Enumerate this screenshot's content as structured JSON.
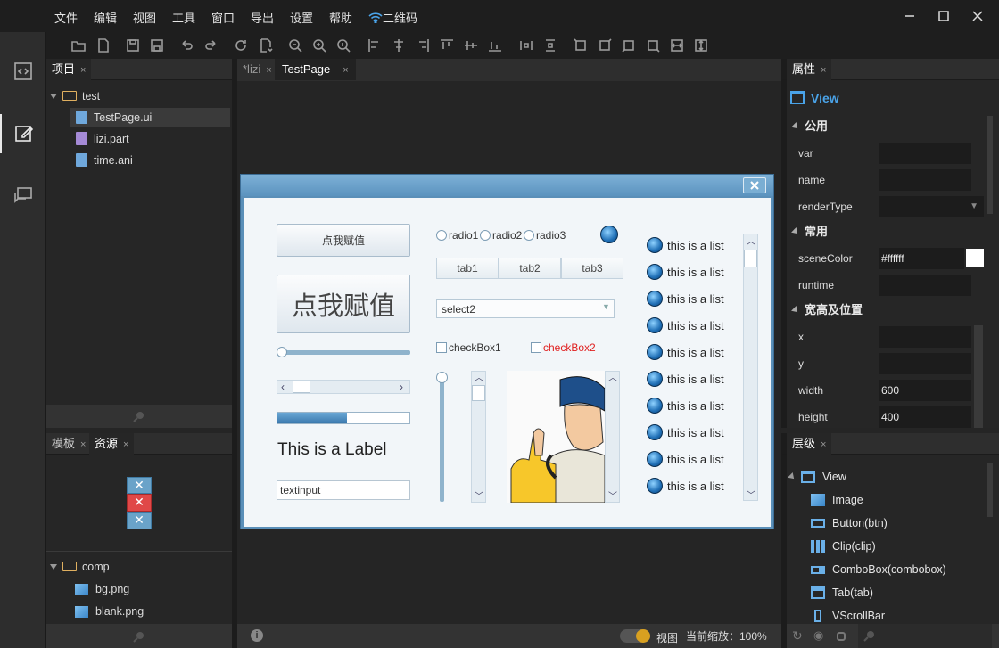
{
  "menu": [
    "文件",
    "编辑",
    "视图",
    "工具",
    "窗口",
    "导出",
    "设置",
    "帮助",
    "二维码"
  ],
  "left_panel": {
    "tabs": [
      "项目"
    ],
    "tree": {
      "root": "test",
      "files": [
        "TestPage.ui",
        "lizi.part",
        "time.ani"
      ]
    }
  },
  "res_panel": {
    "tabs": [
      "模板",
      "资源"
    ],
    "tree": {
      "root": "comp",
      "files": [
        "bg.png",
        "blank.png"
      ]
    }
  },
  "editor": {
    "tabs": [
      "*lizi",
      "TestPage"
    ]
  },
  "canvas": {
    "button_small": "点我赋值",
    "button_large": "点我赋值",
    "radios": [
      "radio1",
      "radio2",
      "radio3"
    ],
    "tabs": [
      "tab1",
      "tab2",
      "tab3"
    ],
    "select_value": "select2",
    "checkboxes": [
      "checkBox1",
      "checkBox2"
    ],
    "label": "This is a Label",
    "textinput": "textinput",
    "list_items": [
      "this is a list",
      "this is a list",
      "this is a list",
      "this is a list",
      "this is a list",
      "this is a list",
      "this is a list",
      "this is a list",
      "this is a list",
      "this is a list"
    ],
    "progress": 0.53,
    "slider": 0.0,
    "colors": {
      "checkbox2": "#e02020"
    }
  },
  "properties": {
    "tab": "属性",
    "component": "View",
    "sections": {
      "common": "公用",
      "frequent": "常用",
      "size": "宽高及位置"
    },
    "rows_common": [
      "var",
      "name",
      "renderType"
    ],
    "rows_frequent": [
      {
        "label": "sceneColor",
        "value": "#ffffff"
      },
      {
        "label": "runtime",
        "value": ""
      }
    ],
    "rows_size": [
      {
        "label": "x",
        "value": ""
      },
      {
        "label": "y",
        "value": ""
      },
      {
        "label": "width",
        "value": "600"
      },
      {
        "label": "height",
        "value": "400"
      }
    ]
  },
  "layers": {
    "tab": "层级",
    "root": "View",
    "items": [
      "Image",
      "Button(btn)",
      "Clip(clip)",
      "ComboBox(combobox)",
      "Tab(tab)",
      "VScrollBar"
    ]
  },
  "status": {
    "view_label": "视图",
    "zoom_text": "当前缩放：100%"
  }
}
